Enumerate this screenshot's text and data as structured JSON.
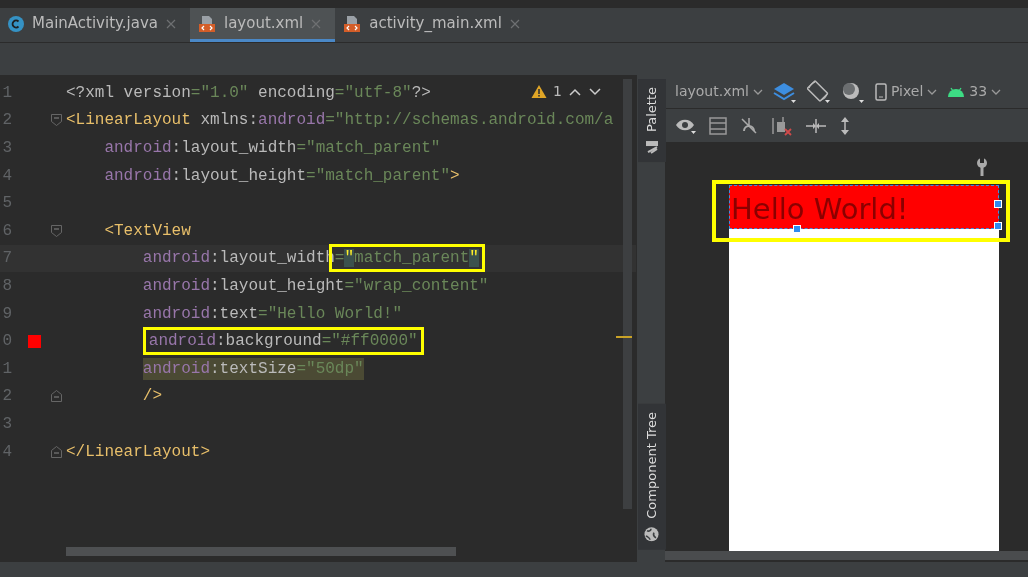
{
  "tabs": [
    {
      "label": "MainActivity.java",
      "kind": "java",
      "selected": false
    },
    {
      "label": "layout.xml",
      "kind": "xml",
      "selected": true
    },
    {
      "label": "activity_main.xml",
      "kind": "xml",
      "selected": false
    }
  ],
  "editor": {
    "warning_count": "1",
    "lines": [
      {
        "number": "1",
        "segments": [
          {
            "tokens": [
              {
                "text": "<?xml version",
                "kind": "plain"
              },
              {
                "text": "=\"1.0\" ",
                "kind": "string"
              },
              {
                "text": "encoding",
                "kind": "plain"
              },
              {
                "text": "=\"utf-8\"",
                "kind": "string"
              },
              {
                "text": "?>",
                "kind": "plain"
              }
            ]
          }
        ]
      },
      {
        "number": "2",
        "fold_start": true,
        "segments": [
          {
            "tokens": [
              {
                "text": "<LinearLayout",
                "kind": "tag"
              },
              {
                "text": " xmlns:",
                "kind": "plain"
              },
              {
                "text": "android",
                "kind": "ns"
              },
              {
                "text": "=\"http://schemas.android.com/a",
                "kind": "string"
              }
            ]
          }
        ],
        "children": [
          {
            "number": "3",
            "segments": [
              {
                "tokens": [
                  {
                    "text": "android",
                    "kind": "ns"
                  },
                  {
                    "text": ":layout_width",
                    "kind": "plain"
                  },
                  {
                    "text": "=\"match_parent\"",
                    "kind": "string"
                  }
                ]
              }
            ]
          },
          {
            "number": "4",
            "segments": [
              {
                "tokens": [
                  {
                    "text": "android",
                    "kind": "ns"
                  },
                  {
                    "text": ":layout_height",
                    "kind": "plain"
                  },
                  {
                    "text": "=\"match_parent\"",
                    "kind": "string"
                  },
                  {
                    "text": ">",
                    "kind": "tag"
                  }
                ]
              }
            ]
          },
          {
            "number": "5"
          },
          {
            "number": "6",
            "fold_start": true,
            "segments": [
              {
                "tokens": [
                  {
                    "text": "<TextView",
                    "kind": "tag"
                  }
                ]
              }
            ],
            "children": [
              {
                "number": "7",
                "current": true,
                "segments": [
                  {
                    "tokens": [
                      {
                        "text": "android",
                        "kind": "ns"
                      },
                      {
                        "text": ":layout_width",
                        "kind": "plain"
                      }
                    ]
                  },
                  {
                    "boxed": true,
                    "tokens": [
                      {
                        "text": "=",
                        "kind": "string"
                      },
                      {
                        "text": "\"",
                        "kind": "string",
                        "matched": true
                      },
                      {
                        "text": "match_parent",
                        "kind": "string"
                      },
                      {
                        "text": "\"",
                        "kind": "string",
                        "matched": true
                      }
                    ]
                  }
                ]
              },
              {
                "number": "8",
                "segments": [
                  {
                    "tokens": [
                      {
                        "text": "android",
                        "kind": "ns"
                      },
                      {
                        "text": ":layout_height",
                        "kind": "plain"
                      },
                      {
                        "text": "=\"wrap_content\"",
                        "kind": "string"
                      }
                    ]
                  }
                ]
              },
              {
                "number": "9",
                "segments": [
                  {
                    "tokens": [
                      {
                        "text": "android",
                        "kind": "ns"
                      },
                      {
                        "text": ":text",
                        "kind": "plain"
                      },
                      {
                        "text": "=\"Hello World!\"",
                        "kind": "string"
                      }
                    ]
                  }
                ]
              },
              {
                "number": "0",
                "color": "#ff0000",
                "segments": [
                  {
                    "boxed": true,
                    "tokens": [
                      {
                        "text": "android",
                        "kind": "ns"
                      },
                      {
                        "text": ":background",
                        "kind": "plain"
                      },
                      {
                        "text": "=\"#ff0000\"",
                        "kind": "string"
                      }
                    ]
                  }
                ]
              },
              {
                "number": "1",
                "selected": true,
                "segments": [
                  {
                    "tokens": [
                      {
                        "text": "android",
                        "kind": "ns"
                      },
                      {
                        "text": ":textSize",
                        "kind": "plain"
                      },
                      {
                        "text": "=\"50dp\"",
                        "kind": "string"
                      }
                    ]
                  }
                ]
              },
              {
                "number": "2",
                "fold_end": true,
                "segments": [
                  {
                    "tokens": [
                      {
                        "text": "/>",
                        "kind": "tag"
                      }
                    ]
                  }
                ]
              }
            ]
          }
        ]
      },
      {
        "number": "3"
      },
      {
        "number": "4",
        "fold_end": true,
        "segments": [
          {
            "tokens": [
              {
                "text": "</LinearLayout>",
                "kind": "tag"
              }
            ]
          }
        ]
      }
    ]
  },
  "side_tabs": {
    "palette": "Palette",
    "component_tree": "Component Tree"
  },
  "design": {
    "file_dropdown": "layout.xml",
    "device": "Pixel",
    "api": "33",
    "preview_text": "Hello World!"
  }
}
